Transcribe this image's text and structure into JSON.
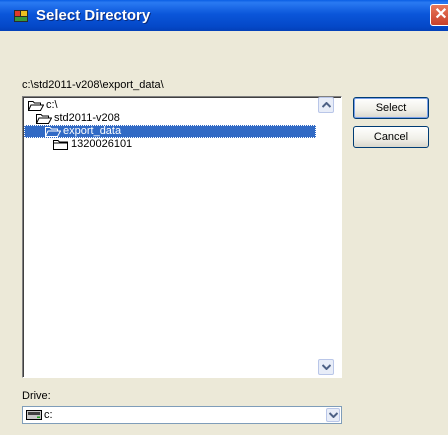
{
  "window": {
    "title": "Select Directory",
    "close_glyph": "✕"
  },
  "current_path": "c:\\std2011-v208\\export_data\\",
  "directory_tree": [
    {
      "label": "c:\\",
      "icon": "open-folder-icon",
      "selected": false
    },
    {
      "label": "std2011-v208",
      "icon": "open-folder-icon",
      "selected": false
    },
    {
      "label": "export_data",
      "icon": "open-folder-icon",
      "selected": true
    },
    {
      "label": "1320026101",
      "icon": "closed-folder-icon",
      "selected": false
    }
  ],
  "buttons": {
    "select_label": "Select",
    "cancel_label": "Cancel"
  },
  "drive": {
    "label": "Drive:",
    "value": "c:",
    "icon": "hard-drive-icon"
  },
  "colors": {
    "titlebar": "#0b56da",
    "selection": "#316ac5",
    "window_bg": "#ece9d8"
  }
}
